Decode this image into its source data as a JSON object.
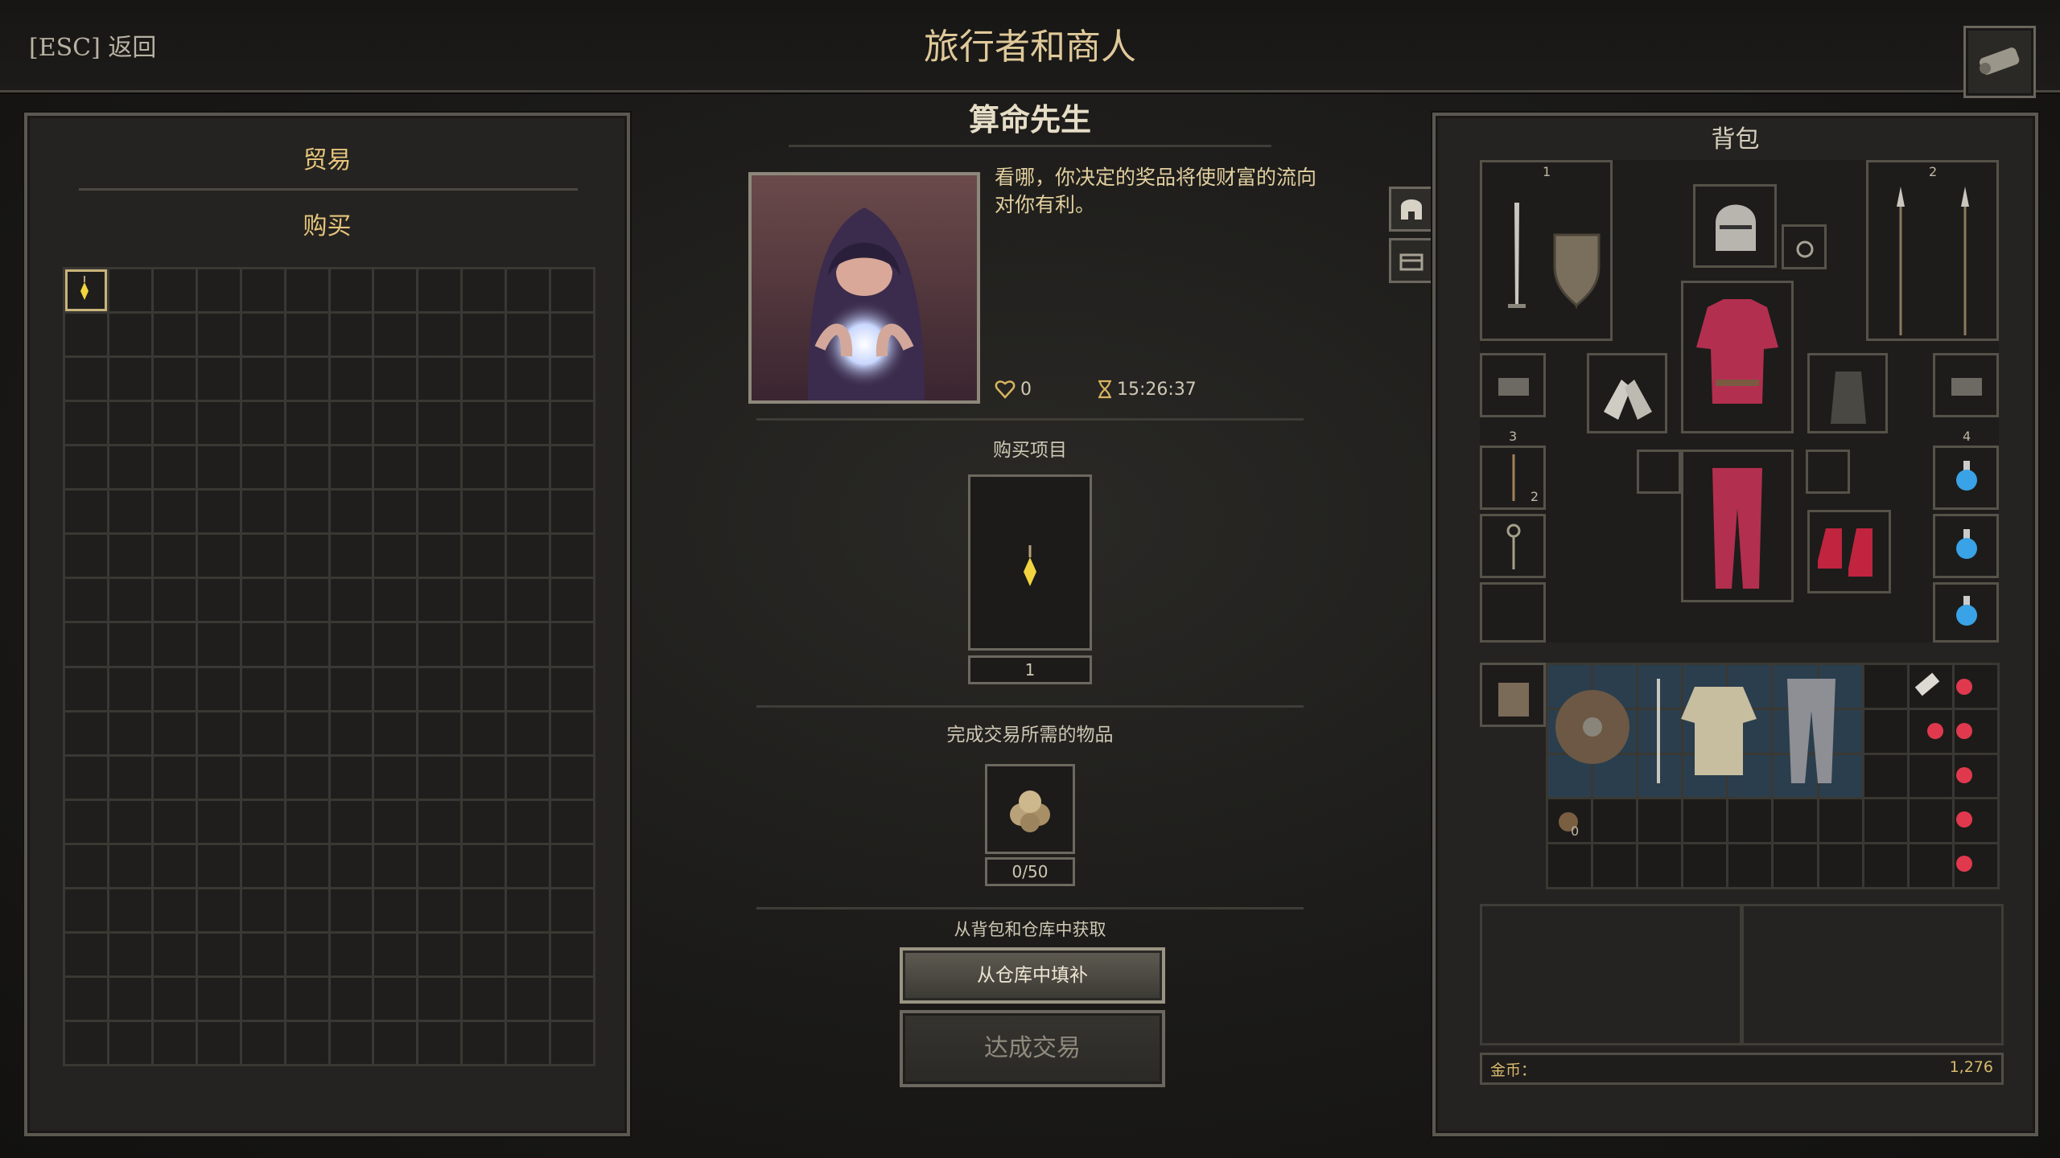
{
  "header": {
    "esc_label": "[ESC] 返回",
    "title": "旅行者和商人"
  },
  "trade_panel": {
    "title": "贸易",
    "buy_title": "购买"
  },
  "merchant": {
    "name": "算命先生",
    "quote": "看哪，你决定的奖品将使财富的流向对你有利。",
    "favor": "0",
    "timer": "15:26:37"
  },
  "purchase": {
    "label": "购买项目",
    "quantity": "1"
  },
  "required": {
    "label": "完成交易所需的物品",
    "count": "0/50"
  },
  "source_label": "从背包和仓库中获取",
  "buttons": {
    "refill": "从仓库中填补",
    "deal": "达成交易"
  },
  "backpack": {
    "title": "背包",
    "weapon_set_1": "1",
    "weapon_set_2": "2",
    "quick_slot_3": "3",
    "quick_slot_4": "4",
    "arrow_count": "2",
    "pouch_count": "0",
    "gold_label": "金币：",
    "gold_value": "1,276"
  },
  "colors": {
    "accent_gold": "#e6c47a",
    "panel_bg": "#242321",
    "selected_bag_cell": "#2a3e4e"
  }
}
